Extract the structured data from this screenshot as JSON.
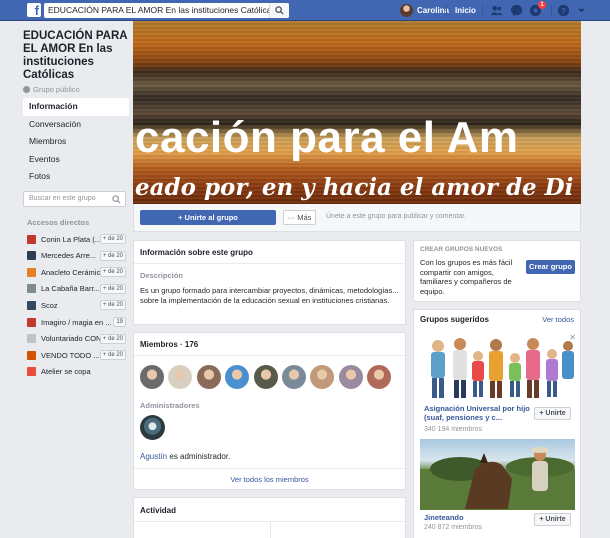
{
  "topbar": {
    "search_value": "EDUCACIÓN PARA EL AMOR En las instituciones Católicas",
    "user_name": "Carolina",
    "home_label": "Inicio",
    "notifications_count": "1"
  },
  "group": {
    "title": "EDUCACIÓN PARA EL AMOR En las instituciones Católicas",
    "privacy": "Grupo público",
    "cover_line1": "cación para el Am",
    "cover_line2": "eado por, en y hacia el amor de Di"
  },
  "nav": {
    "items": [
      {
        "label": "Información",
        "active": true
      },
      {
        "label": "Conversación"
      },
      {
        "label": "Miembros"
      },
      {
        "label": "Eventos"
      },
      {
        "label": "Fotos"
      }
    ],
    "search_placeholder": "Buscar en este grupo"
  },
  "shortcuts": {
    "heading": "Accesos directos",
    "items": [
      {
        "label": "Conin La Plata (...",
        "count": "+ de 20",
        "color": "#c0392b"
      },
      {
        "label": "Mercedes Arre...",
        "count": "+ de 20",
        "color": "#2c3e50"
      },
      {
        "label": "Anacleto Cerámicos y ...",
        "count": "+ de 20",
        "color": "#e67e22"
      },
      {
        "label": "La Cabaña Barr...",
        "count": "+ de 20",
        "color": "#7f8c8d"
      },
      {
        "label": "Scoz",
        "count": "+ de 20",
        "color": "#34495e"
      },
      {
        "label": "Imagiro / magia en ...",
        "count": "19",
        "color": "#c0392b"
      },
      {
        "label": "Voluntariado CONIN ...",
        "count": "+ de 20",
        "color": "#bdc3c7"
      },
      {
        "label": "VENDO TODO ...",
        "count": "+ de 20",
        "color": "#d35400"
      },
      {
        "label": "Atelier se copa",
        "count": "",
        "color": "#e74c3c"
      }
    ]
  },
  "actions": {
    "join_label": "+ Unirte al grupo",
    "more_label": "··· Más",
    "join_hint": "Únete a este grupo para publicar y comentar."
  },
  "info": {
    "heading": "Información sobre este grupo",
    "description_label": "Descripción",
    "description": "Es un grupo formado para intercambiar proyectos, dinámicas, metodologías... sobre la implementación de la educación sexual en instituciones cristianas."
  },
  "members": {
    "heading": "Miembros · 176",
    "avatar_colors": [
      "#6b6b6b",
      "#d8cfc0",
      "#8a6a5a",
      "#4a90d0",
      "#5a5a4a",
      "#7a8a9a",
      "#c09a7a",
      "#9a8aa0",
      "#b06a5a"
    ],
    "admins_label": "Administradores",
    "admin_name": "Agustín",
    "admin_suffix": " es administrador.",
    "see_all": "Ver todos los miembros"
  },
  "activity": {
    "heading": "Actividad"
  },
  "create_group": {
    "heading": "CREAR GRUPOS NUEVOS",
    "text": "Con los grupos es más fácil compartir con amigos, familiares y compañeros de equipo.",
    "button": "Crear grupo"
  },
  "suggested": {
    "heading": "Grupos sugeridos",
    "see_all": "Ver todos",
    "items": [
      {
        "name": "Asignación Universal por hijo (suaf, pensiones y c...",
        "members": "340 194 miembros",
        "join": "+ Unirte"
      },
      {
        "name": "Jineteando",
        "members": "240 872 miembros",
        "join": "+ Unirte"
      }
    ]
  }
}
